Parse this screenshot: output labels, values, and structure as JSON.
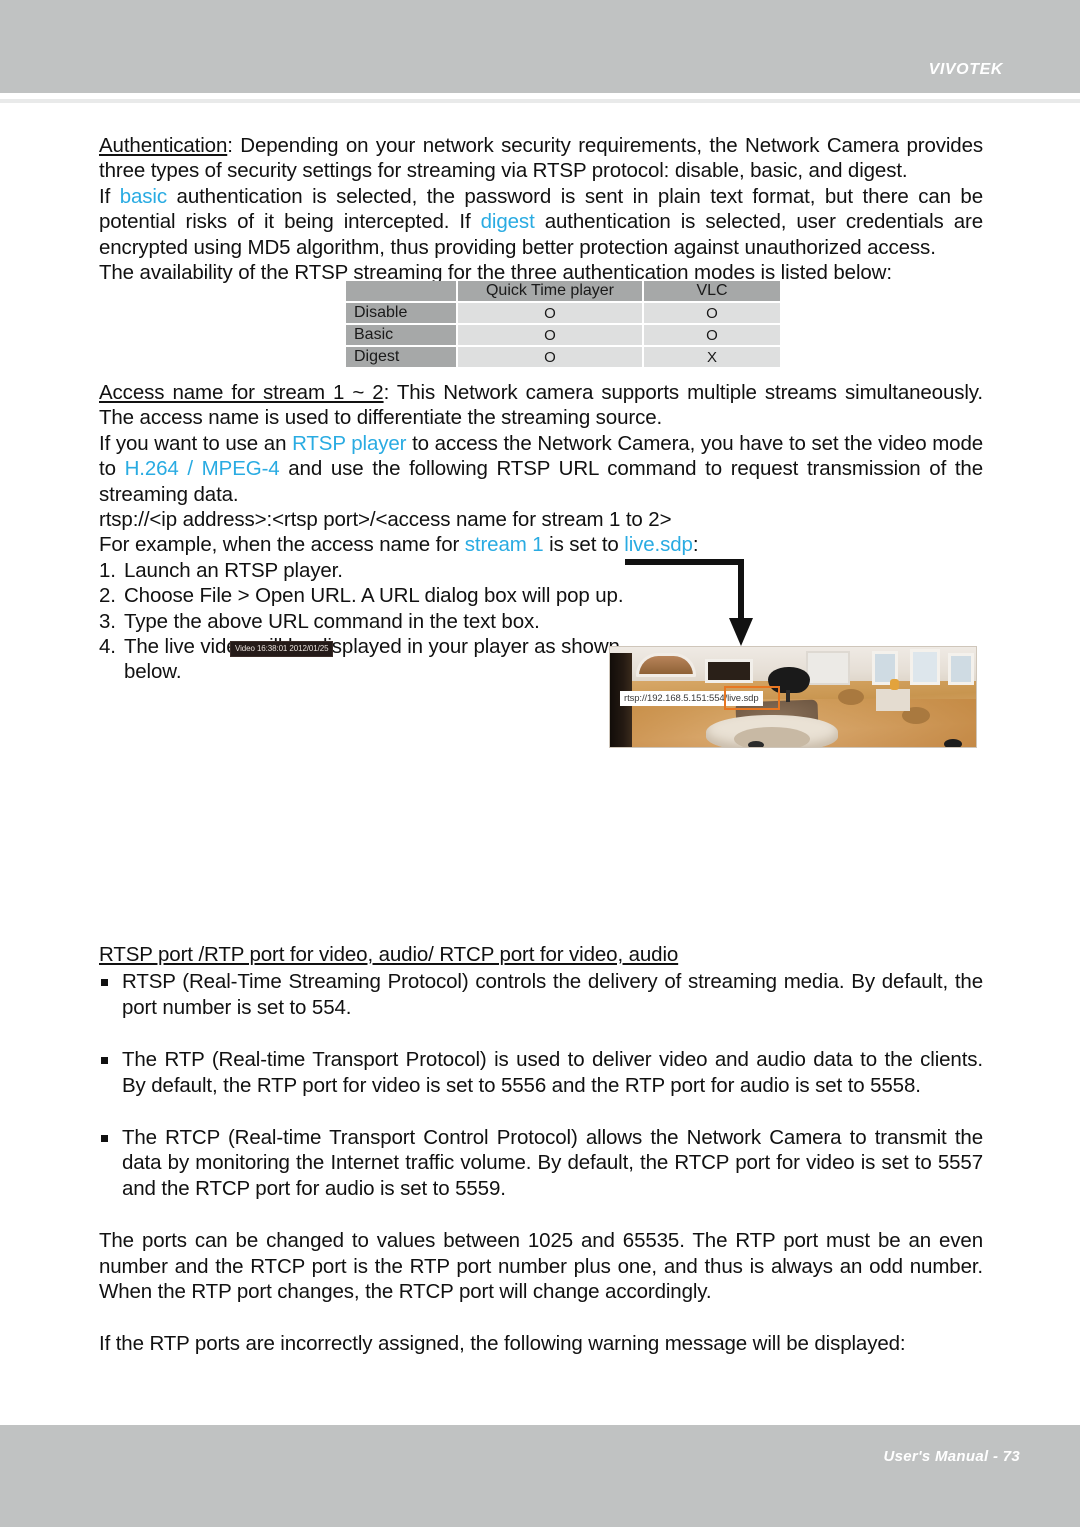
{
  "header": {
    "brand": "VIVOTEK"
  },
  "footer": {
    "page_label": "User's Manual - 73"
  },
  "colors": {
    "header_bar": "#c0c2c2",
    "accent_blue": "#29ABE2",
    "highlight_orange": "#E87722",
    "table_head": "#a6a8a8",
    "table_cell": "#dedfdf"
  },
  "sections": {
    "authentication": {
      "term": "Authentication",
      "p1_a": ": Depending on your network security requirements, the Network Camera provides three types of security settings for streaming via RTSP protocol: disable, basic, and digest.",
      "p2_a": "If ",
      "p2_basic": "basic",
      "p2_b": " authentication is selected, the password is sent in plain text format, but there can be potential risks of it being intercepted. If ",
      "p2_digest": "digest",
      "p2_c": " authentication is selected, user credentials are encrypted using MD5 algorithm, thus providing better protection against unauthorized access.",
      "p3": "The availability of the RTSP streaming for the three authentication modes is listed below:"
    },
    "access_name": {
      "term": "Access name for stream 1 ~ 2",
      "p1": ": This Network camera supports multiple streams simultaneously. The access name is used to differentiate the streaming source.",
      "p2_a": "If you want to use an ",
      "p2_rtsp_player": "RTSP player",
      "p2_b": " to access the Network Camera, you have to set the video mode to ",
      "p2_h264": "H.264 / MPEG-4",
      "p2_c": " and use the following RTSP URL command to request transmission of the streaming data.",
      "url_template": "rtsp://<ip address>:<rtsp port>/<access name for stream 1 to 2>",
      "example_a": "For example, when the access name for ",
      "example_stream": "stream 1",
      "example_b": " is set to ",
      "example_sdp": "live.sdp",
      "example_c": ":",
      "steps": [
        {
          "num": "1.",
          "text": "Launch an RTSP player."
        },
        {
          "num": "2.",
          "text": "Choose File > Open URL. A URL dialog box will pop up."
        },
        {
          "num": "3.",
          "text": "Type the above URL command in the text box."
        },
        {
          "num": "4.",
          "text": "The live video will be displayed in your player as shown below."
        }
      ]
    },
    "ports": {
      "heading": "RTSP port /RTP port for video, audio/ RTCP port for video, audio",
      "bullets": [
        "RTSP (Real-Time Streaming Protocol) controls the delivery of streaming media. By default, the port number is set to 554.",
        "The RTP (Real-time Transport Protocol) is used to deliver video and audio data to the clients. By default, the RTP port for video is set to 5556 and the RTP port for audio is set to 5558.",
        "The RTCP (Real-time Transport Control Protocol) allows the Network Camera to transmit the data by monitoring the Internet traffic volume. By default, the RTCP port for video is set to 5557 and the RTCP port for audio is set to 5559."
      ],
      "p_range": "The ports can be changed to values between 1025 and 65535. The RTP port must be an even number and the RTCP port is the RTP port number plus one, and thus is always an odd number. When the RTP port changes, the RTCP port will change accordingly.",
      "p_warning": "If the RTP ports are incorrectly assigned, the following warning message will be displayed:"
    }
  },
  "availability_table": {
    "columns": [
      "",
      "Quick Time player",
      "VLC"
    ],
    "rows": [
      {
        "mode": "Disable",
        "quicktime": "O",
        "vlc": "O"
      },
      {
        "mode": "Basic",
        "quicktime": "O",
        "vlc": "O"
      },
      {
        "mode": "Digest",
        "quicktime": "O",
        "vlc": "X"
      }
    ]
  },
  "video_screenshot": {
    "timestamp_chip": "Video 16:38:01 2012/01/25",
    "url_overlay": "rtsp://192.168.5.151:554/live.sdp",
    "highlight_token": "live.sdp"
  }
}
